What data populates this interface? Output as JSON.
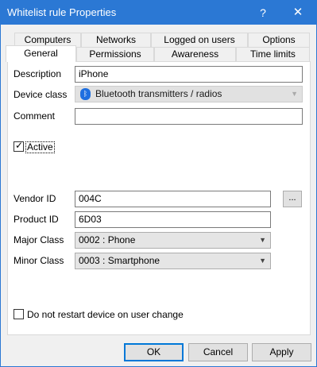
{
  "window": {
    "title": "Whitelist rule Properties",
    "help_glyph": "?",
    "close_glyph": "✕",
    "accent_color": "#2b78d4"
  },
  "tabs": {
    "row1": [
      {
        "label": "Computers"
      },
      {
        "label": "Networks"
      },
      {
        "label": "Logged on users"
      },
      {
        "label": "Options"
      }
    ],
    "row2": [
      {
        "label": "General",
        "active": true
      },
      {
        "label": "Permissions"
      },
      {
        "label": "Awareness"
      },
      {
        "label": "Time limits"
      }
    ]
  },
  "general": {
    "description_label": "Description",
    "description_value": "iPhone",
    "device_class_label": "Device class",
    "device_class_value": "Bluetooth transmitters / radios",
    "device_class_icon": "bluetooth-icon",
    "comment_label": "Comment",
    "comment_value": "",
    "active_label": "Active",
    "active_checked": true,
    "vendor_id_label": "Vendor ID",
    "vendor_id_value": "004C",
    "browse_label": "...",
    "product_id_label": "Product ID",
    "product_id_value": "6D03",
    "major_class_label": "Major Class",
    "major_class_value": "0002 : Phone",
    "minor_class_label": "Minor Class",
    "minor_class_value": "0003 : Smartphone",
    "no_restart_label": "Do not restart device on user change",
    "no_restart_checked": false
  },
  "buttons": {
    "ok": "OK",
    "cancel": "Cancel",
    "apply": "Apply"
  }
}
